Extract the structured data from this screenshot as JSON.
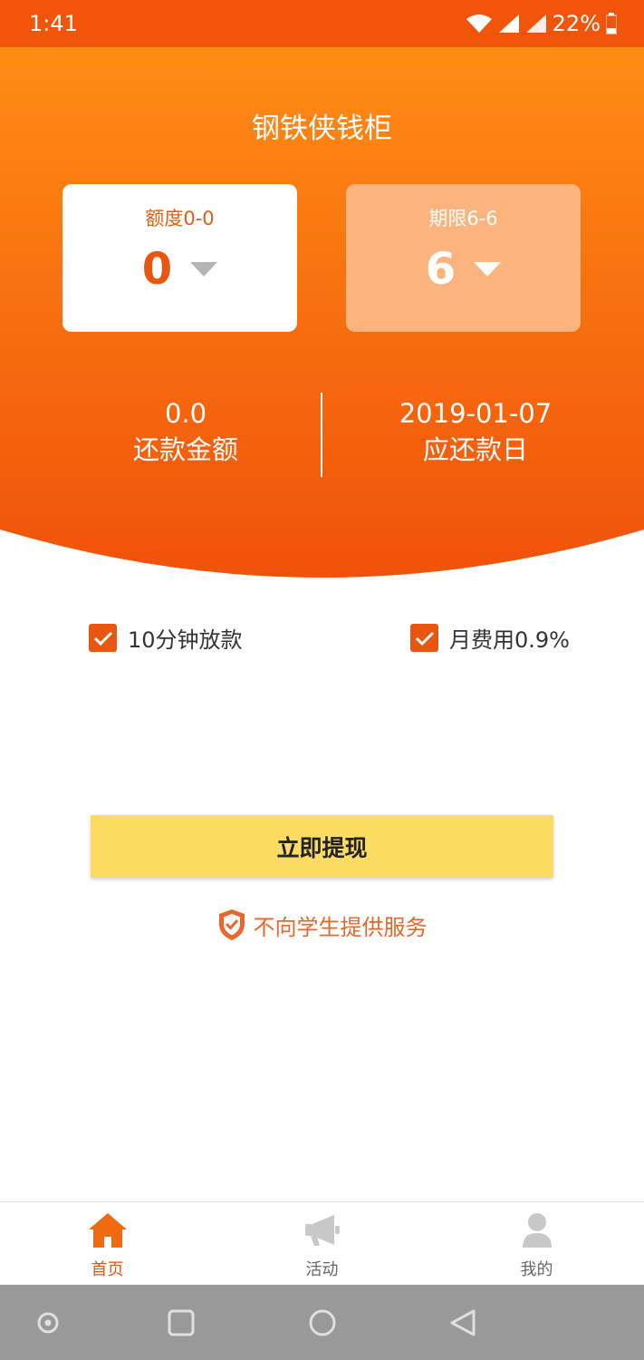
{
  "status_bar": {
    "time": "1:41",
    "battery": "22%"
  },
  "app_title": "钢铁侠钱柜",
  "amount_card": {
    "label": "额度0-0",
    "value": "0"
  },
  "term_card": {
    "label": "期限6-6",
    "value": "6"
  },
  "repayment": {
    "amount": "0.0",
    "amount_label": "还款金额",
    "date": "2019-01-07",
    "date_label": "应还款日"
  },
  "features": [
    {
      "label": "10分钟放款",
      "checked": true
    },
    {
      "label": "月费用0.9%",
      "checked": true
    }
  ],
  "cta_label": "立即提现",
  "notice": "不向学生提供服务",
  "tabs": [
    {
      "label": "首页",
      "icon": "home-icon",
      "active": true
    },
    {
      "label": "活动",
      "icon": "megaphone-icon",
      "active": false
    },
    {
      "label": "我的",
      "icon": "user-icon",
      "active": false
    }
  ],
  "colors": {
    "primary": "#f0550a",
    "gradient_top": "#ff8c14",
    "accent_button": "#fcdb62",
    "term_card": "#fbb47d"
  }
}
